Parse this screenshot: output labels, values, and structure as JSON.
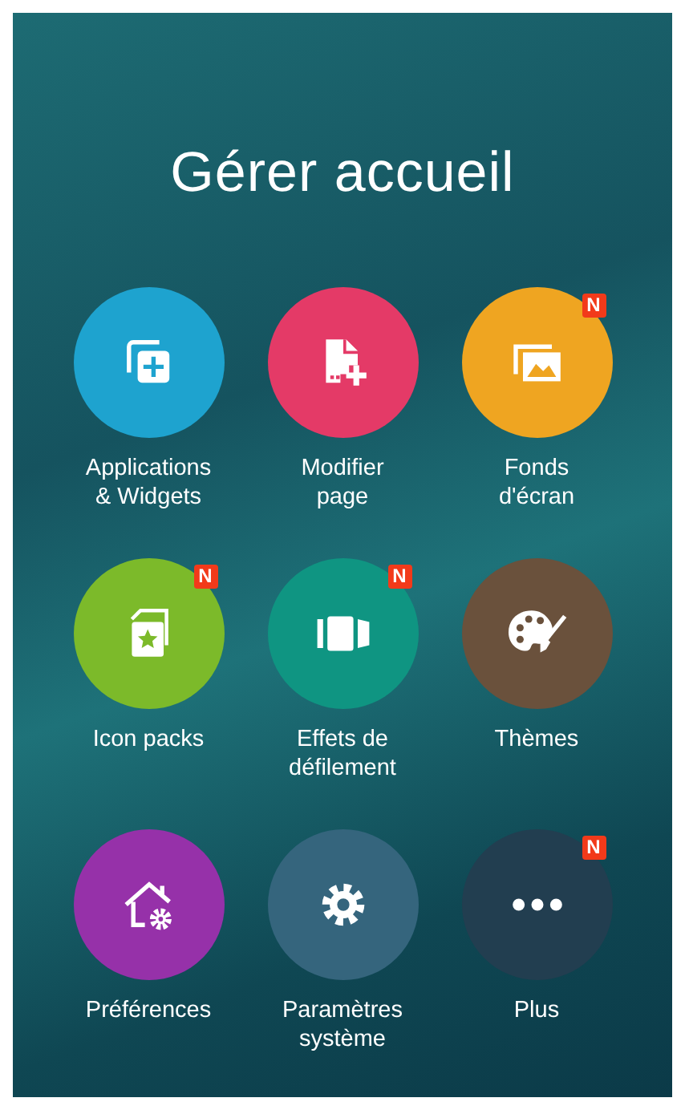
{
  "title": "Gérer accueil",
  "items": [
    {
      "label": "Applications\n& Widgets",
      "kind": "apps",
      "color": "#1ea3cf"
    },
    {
      "label": "Modifier\npage",
      "kind": "page",
      "color": "#e43a67"
    },
    {
      "label": "Fonds\nd'écran",
      "kind": "wallpaper",
      "color": "#efa521",
      "badge": "N"
    },
    {
      "label": "Icon packs",
      "kind": "iconpack",
      "color": "#7cba2a",
      "badge": "N"
    },
    {
      "label": "Effets de\ndéfilement",
      "kind": "scroll",
      "color": "#0f9582",
      "badge": "N"
    },
    {
      "label": "Thèmes",
      "kind": "themes",
      "color": "#6a513c"
    },
    {
      "label": "Préférences",
      "kind": "prefs",
      "color": "#9631a9"
    },
    {
      "label": "Paramètres\nsystème",
      "kind": "settings",
      "color": "#35657d"
    },
    {
      "label": "Plus",
      "kind": "more",
      "color": "#223e50",
      "badge": "N"
    }
  ]
}
